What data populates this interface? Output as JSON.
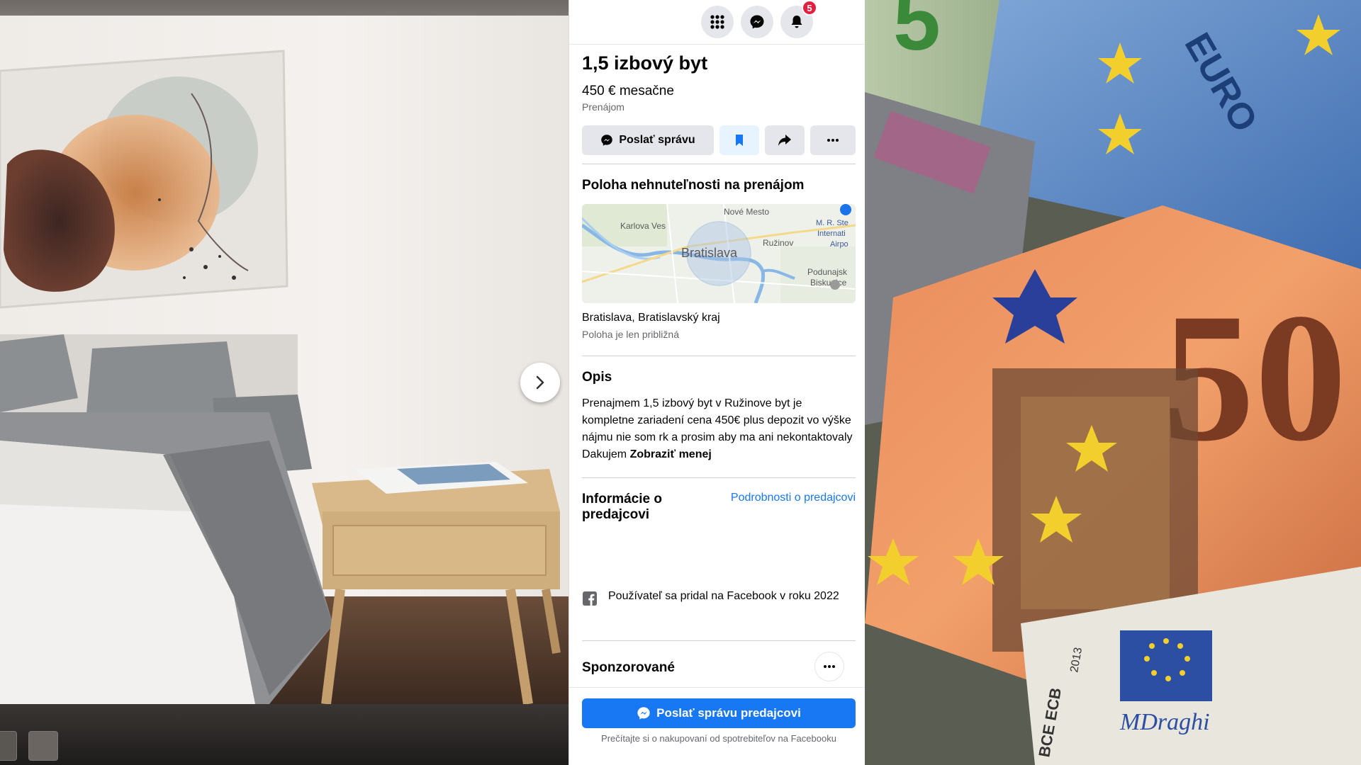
{
  "nav": {
    "menu_icon": "grid-icon",
    "messenger_icon": "messenger-icon",
    "notifications_icon": "bell-icon",
    "notifications_count": "5"
  },
  "listing": {
    "title": "1,5 izbový byt",
    "price": "450 € mesačne",
    "type": "Prenájom"
  },
  "actions": {
    "send_message_label": "Poslať správu",
    "save_icon": "bookmark-icon",
    "share_icon": "share-icon",
    "more_icon": "more-icon"
  },
  "location": {
    "section_title": "Poloha nehnuteľnosti na prenájom",
    "map_labels": {
      "city": "Bratislava",
      "district_1": "Karlova Ves",
      "district_2": "Nové Mesto",
      "district_3": "Ružinov",
      "district_4": "M. R. Ste",
      "district_4b": "Internati",
      "district_4c": "Airpo",
      "district_5": "Podunajsk",
      "district_5b": "Biskupice"
    },
    "place": "Bratislava, Bratislavský kraj",
    "note": "Poloha je len približná"
  },
  "description": {
    "section_title": "Opis",
    "text": "Prenajmem 1,5 izbový byt v Ružinove byt je kompletne zariadení cena 450€ plus depozit vo výške nájmu nie som rk a prosim aby ma ani nekontaktovaly Dakujem ",
    "toggle": "Zobraziť menej"
  },
  "seller": {
    "section_title": "Informácie o predajcovi",
    "details_link": "Podrobnosti o predajcovi",
    "joined": "Používateľ sa pridal na Facebook v roku 2022"
  },
  "sponsored": {
    "title": "Sponzorované"
  },
  "footer": {
    "message_seller": "Poslať správu predajcovi",
    "consumer_info": "Prečítajte si o nakupovaní od spotrebiteľov na Facebooku"
  },
  "colors": {
    "brand_blue": "#1877f2",
    "badge_red": "#e41e3f",
    "button_gray": "#e4e6eb"
  },
  "images": {
    "left_photo": "bedroom-photo",
    "right_photo": "euro-banknotes-photo",
    "money_text": {
      "note_50": "50",
      "euro": "EURO",
      "ecb": "BCE ECB",
      "year": "2013",
      "signature": "MDraghi",
      "five": "5"
    }
  }
}
